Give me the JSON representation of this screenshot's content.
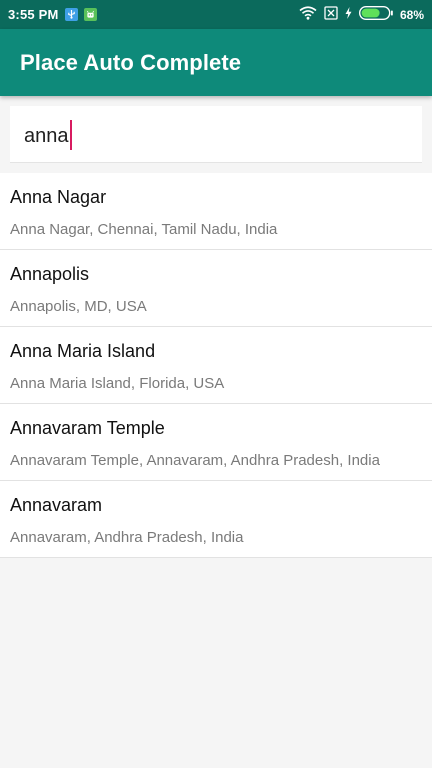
{
  "status_bar": {
    "time": "3:55 PM",
    "battery_percent": "68%",
    "battery_level": 0.68,
    "icons": [
      "usb-notification-icon",
      "android-notification-icon",
      "wifi-icon",
      "no-sim-icon",
      "charging-bolt-icon",
      "battery-icon"
    ]
  },
  "app_bar": {
    "title": "Place Auto Complete"
  },
  "search": {
    "value": "anna"
  },
  "results": [
    {
      "title": "Anna Nagar",
      "subtitle": "Anna Nagar, Chennai, Tamil Nadu, India"
    },
    {
      "title": "Annapolis",
      "subtitle": "Annapolis, MD, USA"
    },
    {
      "title": "Anna Maria Island",
      "subtitle": "Anna Maria Island, Florida, USA"
    },
    {
      "title": "Annavaram Temple",
      "subtitle": "Annavaram Temple, Annavaram, Andhra Pradesh, India"
    },
    {
      "title": "Annavaram",
      "subtitle": "Annavaram, Andhra Pradesh, India"
    }
  ],
  "colors": {
    "status_bar": "#0b6a5c",
    "app_bar": "#0e8a7a",
    "cursor": "#d81b60",
    "background": "#f5f5f5"
  }
}
